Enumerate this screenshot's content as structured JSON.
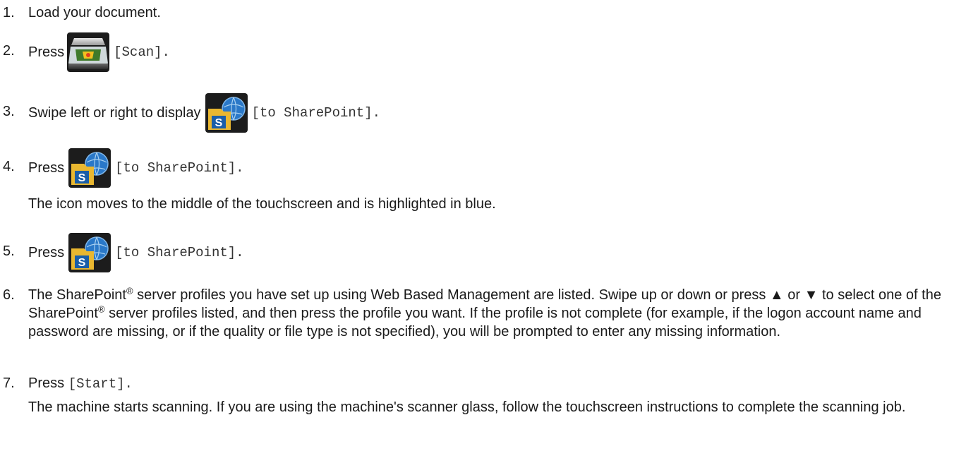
{
  "steps": [
    {
      "number": "1.",
      "text": "Load your document."
    },
    {
      "number": "2.",
      "lead": "Press",
      "icon": "scanner-icon",
      "label": "[Scan]."
    },
    {
      "number": "3.",
      "lead": "Swipe left or right to display",
      "icon": "sharepoint-icon",
      "label": "[to SharePoint]."
    },
    {
      "number": "4.",
      "lead": "Press",
      "icon": "sharepoint-icon",
      "label": "[to SharePoint].",
      "note": "The icon moves to the middle of the touchscreen and is highlighted in blue."
    },
    {
      "number": "5.",
      "lead": "Press",
      "icon": "sharepoint-icon",
      "label": "[to SharePoint]."
    },
    {
      "number": "6.",
      "part1": "The SharePoint",
      "reg": "®",
      "part2": " server profiles you have set up using Web Based Management are listed. Swipe up or down or press ▲ or ▼ to select one of the SharePoint",
      "part3": " server profiles listed, and then press the profile you want. If the profile is not complete (for example, if the logon account name and password are missing, or if the quality or file type is not specified), you will be prompted to enter any missing information."
    },
    {
      "number": "7.",
      "lead": "Press",
      "label": "[Start].",
      "note": "The machine starts scanning. If you are using the machine's scanner glass, follow the touchscreen instructions to complete the scanning job."
    }
  ],
  "colors": {
    "text": "#1a1a1a",
    "icon_blue": "#1a5ea8",
    "folder_yellow": "#e9b730"
  }
}
